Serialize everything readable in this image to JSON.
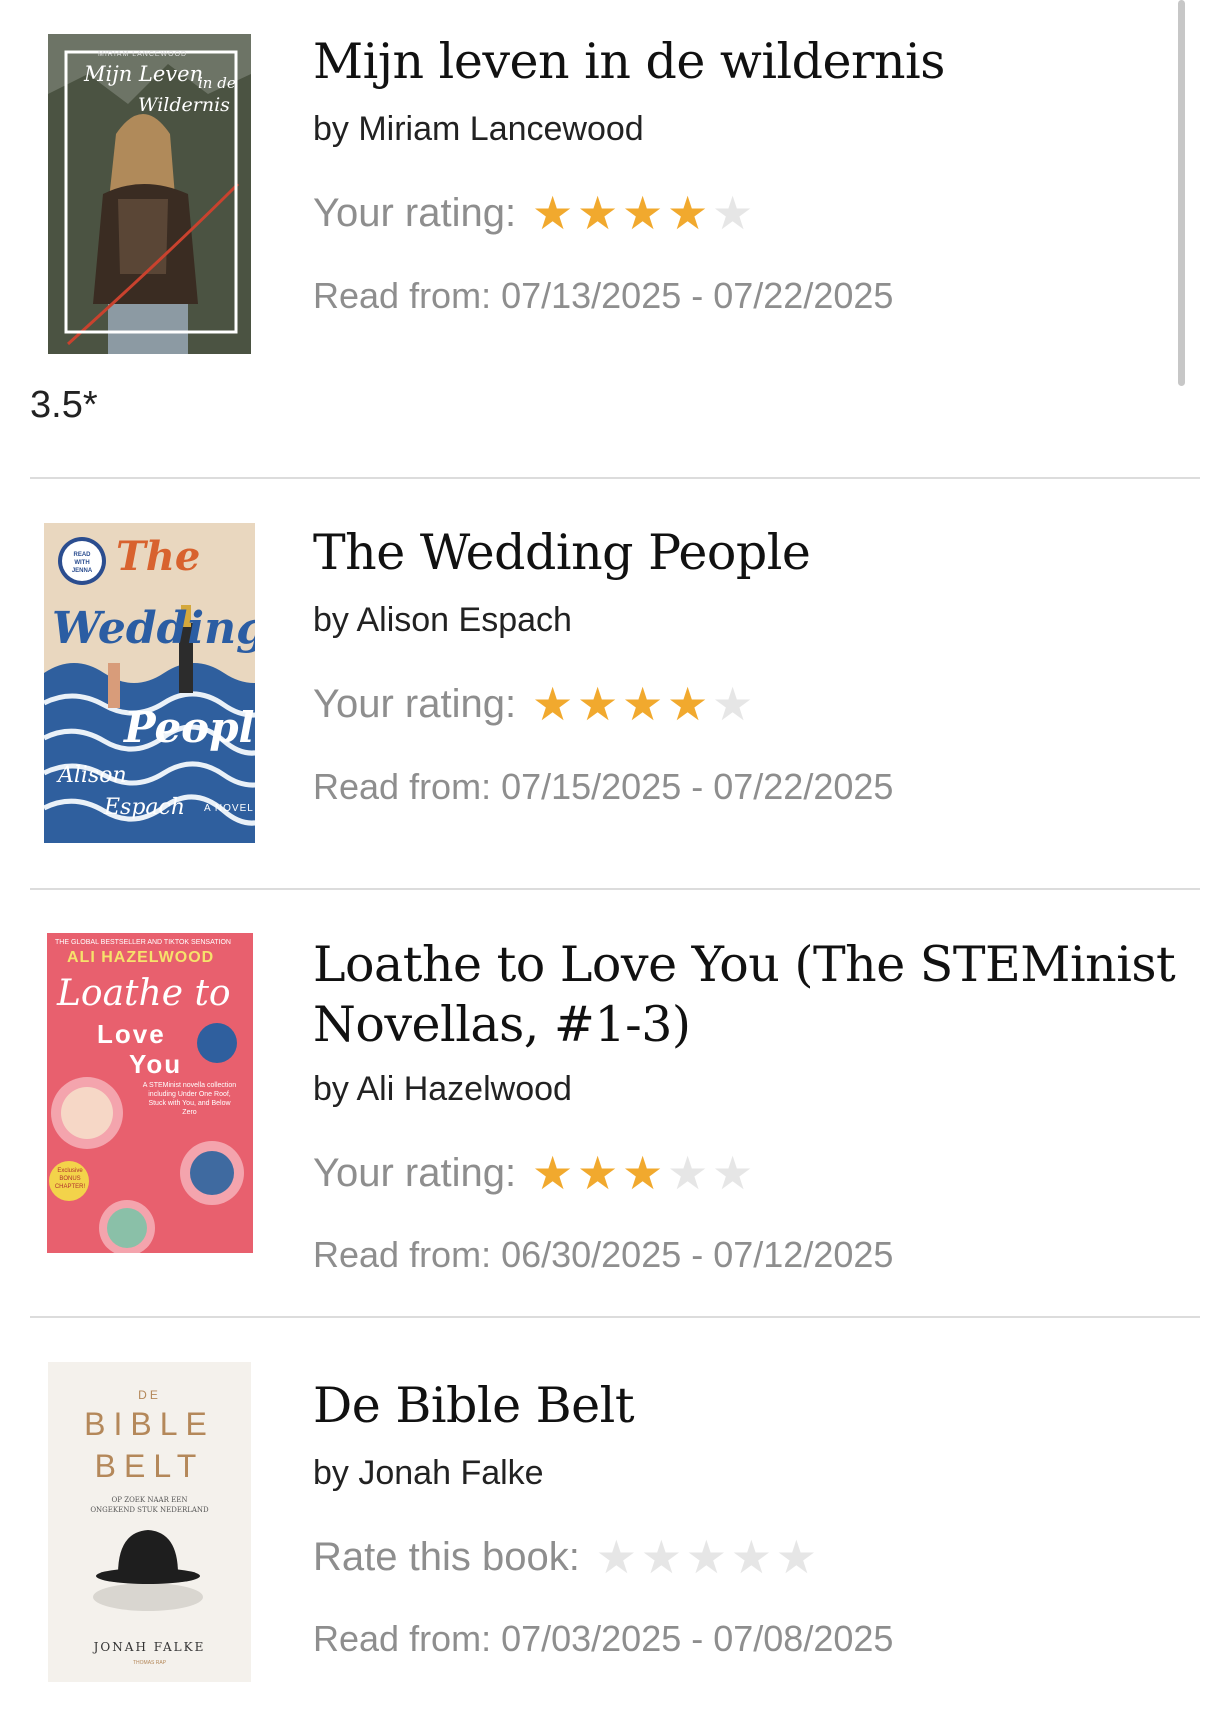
{
  "books": [
    {
      "title": "Mijn leven in de wildernis",
      "author": "by Miriam Lancewood",
      "rating_label": "Your rating:",
      "rating": 4,
      "dates": "Read from: 07/13/2025 - 07/22/2025",
      "note": "3.5*",
      "cover": {
        "title_line1": "Mijn Leven",
        "title_line2": "in de",
        "title_line3": "Wildernis",
        "author": "MIRIAM LANCEWOOD"
      }
    },
    {
      "title": "The Wedding People",
      "author": "by Alison Espach",
      "rating_label": "Your rating:",
      "rating": 4,
      "dates": "Read from: 07/15/2025 - 07/22/2025",
      "cover": {
        "badge": "READ WITH JENNA",
        "word1": "The",
        "word2": "Wedding",
        "word3": "People",
        "author1": "Alison",
        "author2": "Espach",
        "tag": "A NOVEL"
      }
    },
    {
      "title": "Loathe to Love You (The STEMinist Novellas, #1-3)",
      "author": "by Ali Hazelwood",
      "rating_label": "Your rating:",
      "rating": 3,
      "dates": "Read from: 06/30/2025 - 07/12/2025",
      "cover": {
        "top": "THE GLOBAL BESTSELLER AND TIKTOK SENSATION",
        "author": "ALI HAZELWOOD",
        "word1": "Loathe to",
        "word2": "Love",
        "word3": "You",
        "blurb": "A STEMinist novella collection including Under One Roof, Stuck with You, and Below Zero",
        "bonus": "Exclusive BONUS CHAPTER!"
      }
    },
    {
      "title": "De Bible Belt",
      "author": "by Jonah Falke",
      "rating_label": "Rate this book:",
      "rating": 0,
      "dates": "Read from: 07/03/2025 - 07/08/2025",
      "cover": {
        "de": "DE",
        "bible": "BIBLE",
        "belt": "BELT",
        "subtitle1": "OP ZOEK NAAR EEN",
        "subtitle2": "ONGEKEND STUK NEDERLAND",
        "author": "JONAH FALKE",
        "publisher": "THOMAS RAP"
      }
    }
  ],
  "colors": {
    "star_on": "#f1a92e",
    "star_off": "#e6e6e6",
    "muted_text": "#8e8e8e"
  }
}
